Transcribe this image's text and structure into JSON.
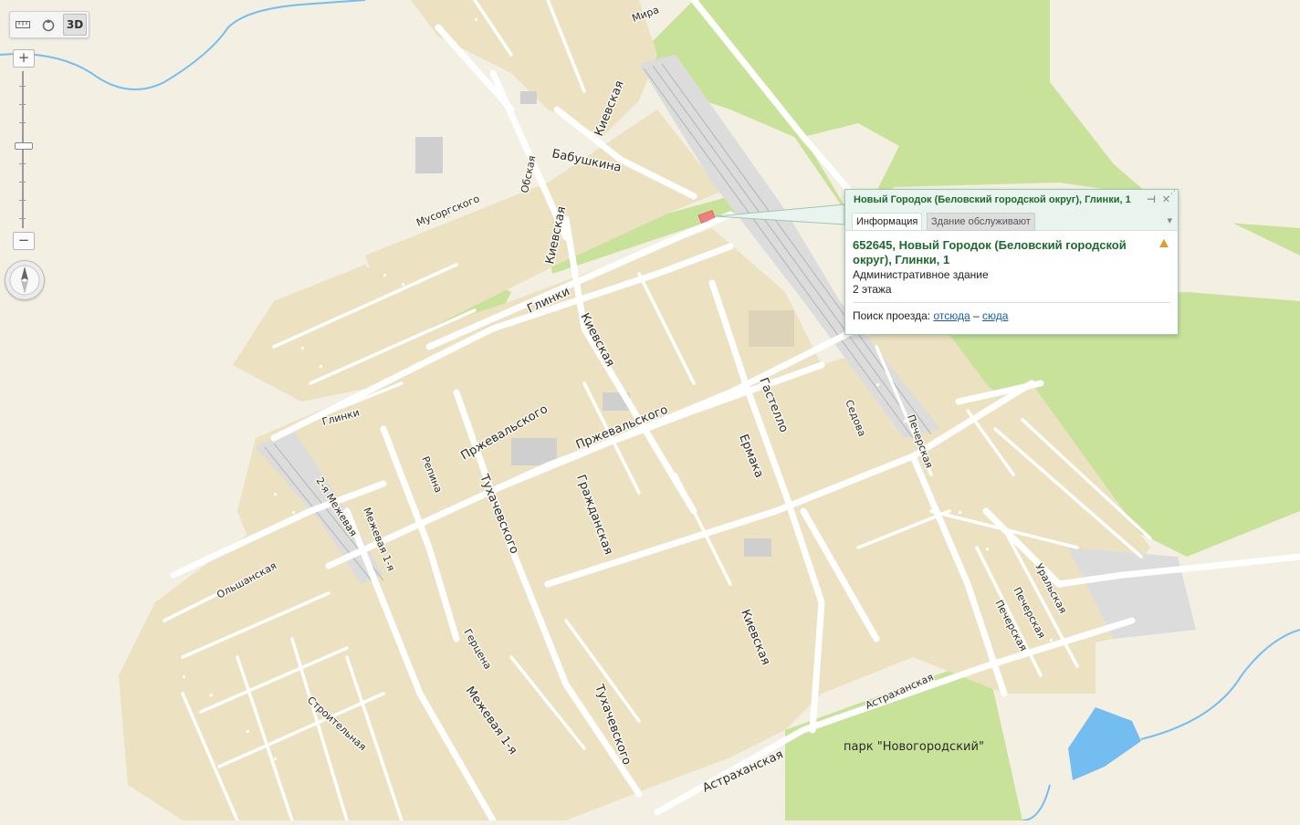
{
  "toolbar": {
    "ruler_icon": "ruler-icon",
    "traffic_icon": "traffic-icon",
    "mode_3d_label": "3D"
  },
  "zoom": {
    "plus": "+",
    "minus": "−"
  },
  "balloon": {
    "title": "Новый Городок (Беловский городской округ), Глинки, 1",
    "tab_info": "Информация",
    "tab_service": "Здание обслуживают",
    "address": "652645, Новый Городок (Беловский городской округ), Глинки, 1",
    "building_type": "Административное здание",
    "floors": "2 этажа",
    "route_label": "Поиск проезда:",
    "route_from": "отсюда",
    "route_dash": "–",
    "route_to": "сюда"
  },
  "streets": {
    "mira": "Мира",
    "kievskaya_top": "Киевская",
    "babushkina": "Бабушкина",
    "obskaya": "Обская",
    "musorgskogo": "Мусоргского",
    "kievskaya_mid": "Киевская",
    "glinki_mid": "Глинки",
    "kievskaya_center": "Киевская",
    "glinki_left": "Глинки",
    "przhevalskogo_1": "Пржевальского",
    "przhevalskogo_2": "Пржевальского",
    "gastello": "Гастелло",
    "sedova": "Седова",
    "pecherskaya_1": "Печерская",
    "ermaka": "Ермака",
    "repina": "Репина",
    "tukhachevskogo_1": "Тухачевского",
    "grazhdanskaya": "Гражданская",
    "mezhevaya_2": "2-я Межевая",
    "mezhevaya_1a": "Межевая 1-я",
    "olshanskaya": "Ольшанская",
    "gertsena": "Герцена",
    "stroitelnaya": "Строительная",
    "mezhevaya_1b": "Межевая 1-я",
    "tukhachevskogo_2": "Тухачевского",
    "kievskaya_bottom": "Киевская",
    "astrakhanskaya_1": "Астраханская",
    "astrakhanskaya_2": "Астраханская",
    "pecherskaya_2": "Печерская",
    "pecherskaya_3": "Печерская",
    "uralskaya": "Уральская",
    "park": "парк \"Новогородский\""
  },
  "colors": {
    "background": "#f3efe2",
    "residential": "#ece1c1",
    "forest": "#c9e29a",
    "water": "#74bdf0",
    "selected_building": "#f07f7f",
    "balloon_title": "#1d6b2c"
  }
}
